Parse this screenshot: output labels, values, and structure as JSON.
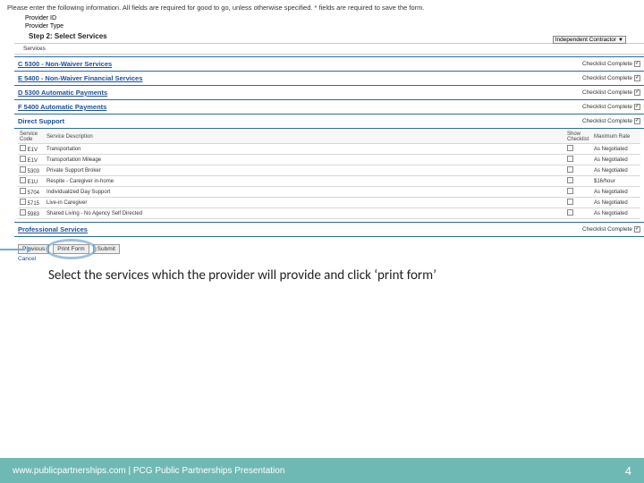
{
  "instructions": "Please enter the following information. All fields are required for good to go, unless otherwise specified. * fields are required to save the form.",
  "fields": {
    "provider_id_label": "Provider ID",
    "provider_type_label": "Provider Type",
    "provider_type_value": "Independent Contractor"
  },
  "step_title": "Step 2: Select Services",
  "services_label": "Services",
  "checklist_label": "Checklist Complete",
  "sections": [
    {
      "label": "C 5300 - Non-Waiver Services"
    },
    {
      "label": "E 5400 - Non-Waiver Financial Services"
    },
    {
      "label": "D 5300 Automatic Payments"
    },
    {
      "label": "F 5400 Automatic Payments"
    },
    {
      "label": "Direct Support",
      "nolink": true
    }
  ],
  "table": {
    "headers": {
      "code": "Service Code",
      "desc": "Service Description",
      "show": "Show Checklist",
      "rate": "Maximum Rate"
    },
    "rows": [
      {
        "code": "E1V",
        "desc": "Transportation",
        "rate": "As Negotiated"
      },
      {
        "code": "E1V",
        "desc": "Transportation Mileage",
        "rate": "As Negotiated"
      },
      {
        "code": "5303",
        "desc": "Private Support Broker",
        "rate": "As Negotiated"
      },
      {
        "code": "E1U",
        "desc": "Respite - Caregiver in-home",
        "rate": "$16/hour"
      },
      {
        "code": "5704",
        "desc": "Individualized Day Support",
        "rate": "As Negotiated"
      },
      {
        "code": "5715",
        "desc": "Live-in Caregiver",
        "rate": "As Negotiated"
      },
      {
        "code": "5983",
        "desc": "Shared Living - No Agency Self Directed",
        "rate": "As Negotiated"
      }
    ]
  },
  "professional_services": "Professional Services",
  "buttons": {
    "previous": "Previous",
    "print": "Print Form",
    "submit": "Submit"
  },
  "cancel_link": "Cancel",
  "caption": "Select the services which the provider will provide and click ‘print form’",
  "footer": {
    "text": "www.publicpartnerships.com | PCG Public Partnerships Presentation",
    "page": "4"
  }
}
